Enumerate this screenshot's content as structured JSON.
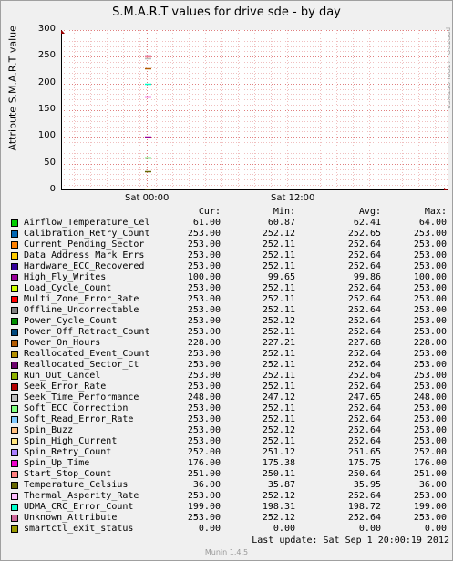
{
  "title": "S.M.A.R.T values for drive sde - by day",
  "side_label": "RRDTOOL / TOBI OETIKER",
  "footer": "Munin 1.4.5",
  "last_update": "Last update: Sat Sep  1 20:00:19 2012",
  "columns": {
    "cur": "Cur:",
    "min": "Min:",
    "avg": "Avg:",
    "max": "Max:"
  },
  "chart_data": {
    "type": "line",
    "ylabel": "Attribute S.M.A.R.T value",
    "ylim": [
      0,
      300
    ],
    "yticks": [
      "0",
      "50",
      "100",
      "150",
      "200",
      "250",
      "300"
    ],
    "xticks": [
      "Sat 00:00",
      "Sat 12:00"
    ],
    "grid": true,
    "series": [
      {
        "name": "Airflow_Temperature_Cel",
        "color": "#00cc00",
        "cur": "61.00",
        "min": "60.87",
        "avg": "62.41",
        "max": "64.00",
        "value": 61
      },
      {
        "name": "Calibration_Retry_Count",
        "color": "#0066b3",
        "cur": "253.00",
        "min": "252.12",
        "avg": "252.65",
        "max": "253.00",
        "value": 253
      },
      {
        "name": "Current_Pending_Sector",
        "color": "#ff8000",
        "cur": "253.00",
        "min": "252.11",
        "avg": "252.64",
        "max": "253.00",
        "value": 253
      },
      {
        "name": "Data_Address_Mark_Errs",
        "color": "#ffcc00",
        "cur": "253.00",
        "min": "252.11",
        "avg": "252.64",
        "max": "253.00",
        "value": 253
      },
      {
        "name": "Hardware_ECC_Recovered",
        "color": "#330099",
        "cur": "253.00",
        "min": "252.11",
        "avg": "252.64",
        "max": "253.00",
        "value": 253
      },
      {
        "name": "High_Fly_Writes",
        "color": "#990099",
        "cur": "100.00",
        "min": "99.65",
        "avg": "99.86",
        "max": "100.00",
        "value": 100
      },
      {
        "name": "Load_Cycle_Count",
        "color": "#ccff00",
        "cur": "253.00",
        "min": "252.11",
        "avg": "252.64",
        "max": "253.00",
        "value": 253
      },
      {
        "name": "Multi_Zone_Error_Rate",
        "color": "#ff0000",
        "cur": "253.00",
        "min": "252.11",
        "avg": "252.64",
        "max": "253.00",
        "value": 253
      },
      {
        "name": "Offline_Uncorrectable",
        "color": "#808080",
        "cur": "253.00",
        "min": "252.11",
        "avg": "252.64",
        "max": "253.00",
        "value": 253
      },
      {
        "name": "Power_Cycle_Count",
        "color": "#008f00",
        "cur": "253.00",
        "min": "252.12",
        "avg": "252.64",
        "max": "253.00",
        "value": 253
      },
      {
        "name": "Power_Off_Retract_Count",
        "color": "#00487d",
        "cur": "253.00",
        "min": "252.11",
        "avg": "252.64",
        "max": "253.00",
        "value": 253
      },
      {
        "name": "Power_On_Hours",
        "color": "#b35a00",
        "cur": "228.00",
        "min": "227.21",
        "avg": "227.68",
        "max": "228.00",
        "value": 228
      },
      {
        "name": "Reallocated_Event_Count",
        "color": "#b38f00",
        "cur": "253.00",
        "min": "252.11",
        "avg": "252.64",
        "max": "253.00",
        "value": 253
      },
      {
        "name": "Reallocated_Sector_Ct",
        "color": "#6b006b",
        "cur": "253.00",
        "min": "252.11",
        "avg": "252.64",
        "max": "253.00",
        "value": 253
      },
      {
        "name": "Run_Out_Cancel",
        "color": "#8fb300",
        "cur": "253.00",
        "min": "252.11",
        "avg": "252.64",
        "max": "253.00",
        "value": 253
      },
      {
        "name": "Seek_Error_Rate",
        "color": "#b30000",
        "cur": "253.00",
        "min": "252.11",
        "avg": "252.64",
        "max": "253.00",
        "value": 253
      },
      {
        "name": "Seek_Time_Performance",
        "color": "#bebebe",
        "cur": "248.00",
        "min": "247.12",
        "avg": "247.65",
        "max": "248.00",
        "value": 248
      },
      {
        "name": "Soft_ECC_Correction",
        "color": "#80ff80",
        "cur": "253.00",
        "min": "252.11",
        "avg": "252.64",
        "max": "253.00",
        "value": 253
      },
      {
        "name": "Soft_Read_Error_Rate",
        "color": "#80c9ff",
        "cur": "253.00",
        "min": "252.11",
        "avg": "252.64",
        "max": "253.00",
        "value": 253
      },
      {
        "name": "Spin_Buzz",
        "color": "#ffc080",
        "cur": "253.00",
        "min": "252.12",
        "avg": "252.64",
        "max": "253.00",
        "value": 253
      },
      {
        "name": "Spin_High_Current",
        "color": "#ffe680",
        "cur": "253.00",
        "min": "252.11",
        "avg": "252.64",
        "max": "253.00",
        "value": 253
      },
      {
        "name": "Spin_Retry_Count",
        "color": "#aa80ff",
        "cur": "252.00",
        "min": "251.12",
        "avg": "251.65",
        "max": "252.00",
        "value": 252
      },
      {
        "name": "Spin_Up_Time",
        "color": "#ee00cc",
        "cur": "176.00",
        "min": "175.38",
        "avg": "175.75",
        "max": "176.00",
        "value": 176
      },
      {
        "name": "Start_Stop_Count",
        "color": "#ff8080",
        "cur": "251.00",
        "min": "250.11",
        "avg": "250.64",
        "max": "251.00",
        "value": 251
      },
      {
        "name": "Temperature_Celsius",
        "color": "#666600",
        "cur": "36.00",
        "min": "35.87",
        "avg": "35.95",
        "max": "36.00",
        "value": 36
      },
      {
        "name": "Thermal_Asperity_Rate",
        "color": "#ffbfff",
        "cur": "253.00",
        "min": "252.12",
        "avg": "252.64",
        "max": "253.00",
        "value": 253
      },
      {
        "name": "UDMA_CRC_Error_Count",
        "color": "#00ffcc",
        "cur": "199.00",
        "min": "198.31",
        "avg": "198.72",
        "max": "199.00",
        "value": 199
      },
      {
        "name": "Unknown_Attribute",
        "color": "#cc6699",
        "cur": "253.00",
        "min": "252.12",
        "avg": "252.64",
        "max": "253.00",
        "value": 253
      },
      {
        "name": "smartctl_exit_status",
        "color": "#999900",
        "cur": "0.00",
        "min": "0.00",
        "avg": "0.00",
        "max": "0.00",
        "value": 0
      }
    ]
  }
}
